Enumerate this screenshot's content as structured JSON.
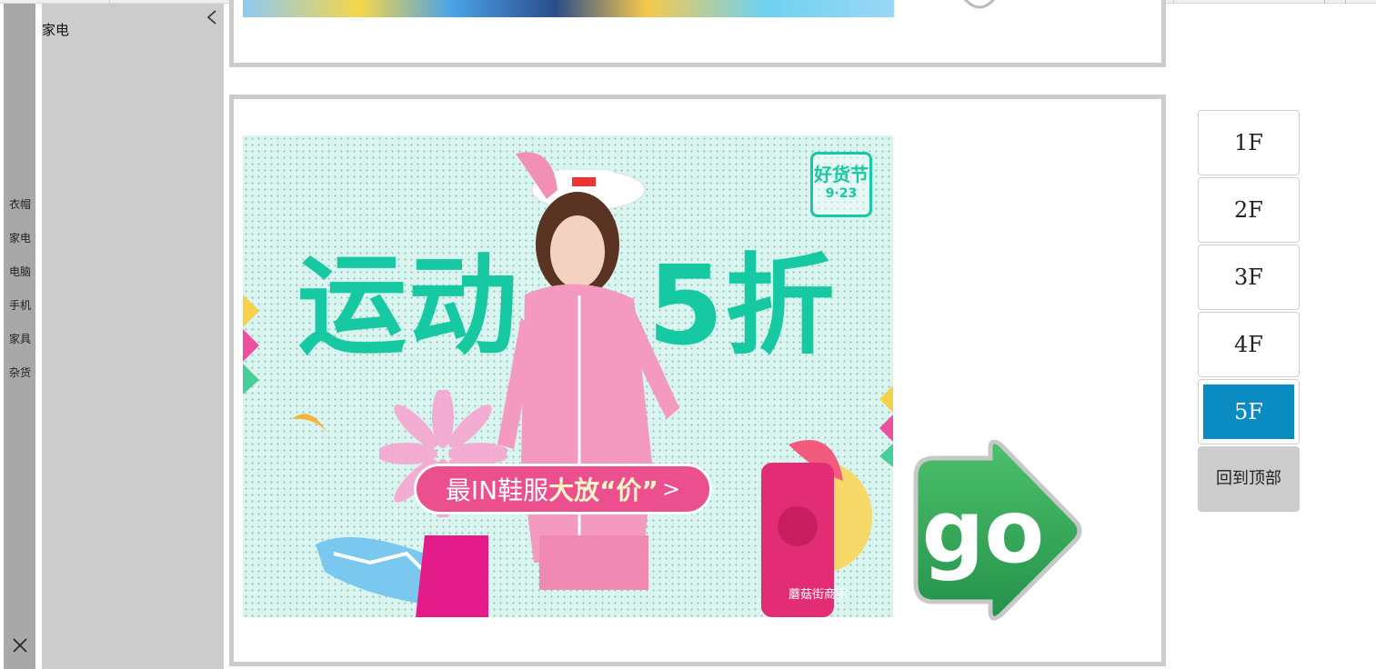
{
  "sidebar": {
    "items": [
      {
        "label": "衣帽"
      },
      {
        "label": "家电"
      },
      {
        "label": "电脑"
      },
      {
        "label": "手机"
      },
      {
        "label": "家具"
      },
      {
        "label": "杂货"
      }
    ],
    "close_icon": "close-icon"
  },
  "panel": {
    "title": "家电",
    "collapse_icon": "chevron-left-icon"
  },
  "banner": {
    "headline_left": "运动",
    "headline_right": "5折",
    "badge_line1": "好货节",
    "badge_line2": "9·23",
    "pill_part1": "最IN鞋服",
    "pill_part2": "大放“价”",
    "pill_arrow": ">",
    "watermark": "蘑菇街商家"
  },
  "go_button": {
    "label": "go",
    "icon": "go-arrow-icon"
  },
  "floor_nav": {
    "floors": [
      "1F",
      "2F",
      "3F",
      "4F",
      "5F"
    ],
    "active": "5F",
    "back_to_top": "回到顶部"
  },
  "colors": {
    "accent": "#0a8bc2",
    "panel_bg": "#cccccc",
    "leftbar_bg": "#a8a8a8",
    "headline": "#17c9a2",
    "pill": "#ec4f8e",
    "go_green": "#2fa84f"
  }
}
